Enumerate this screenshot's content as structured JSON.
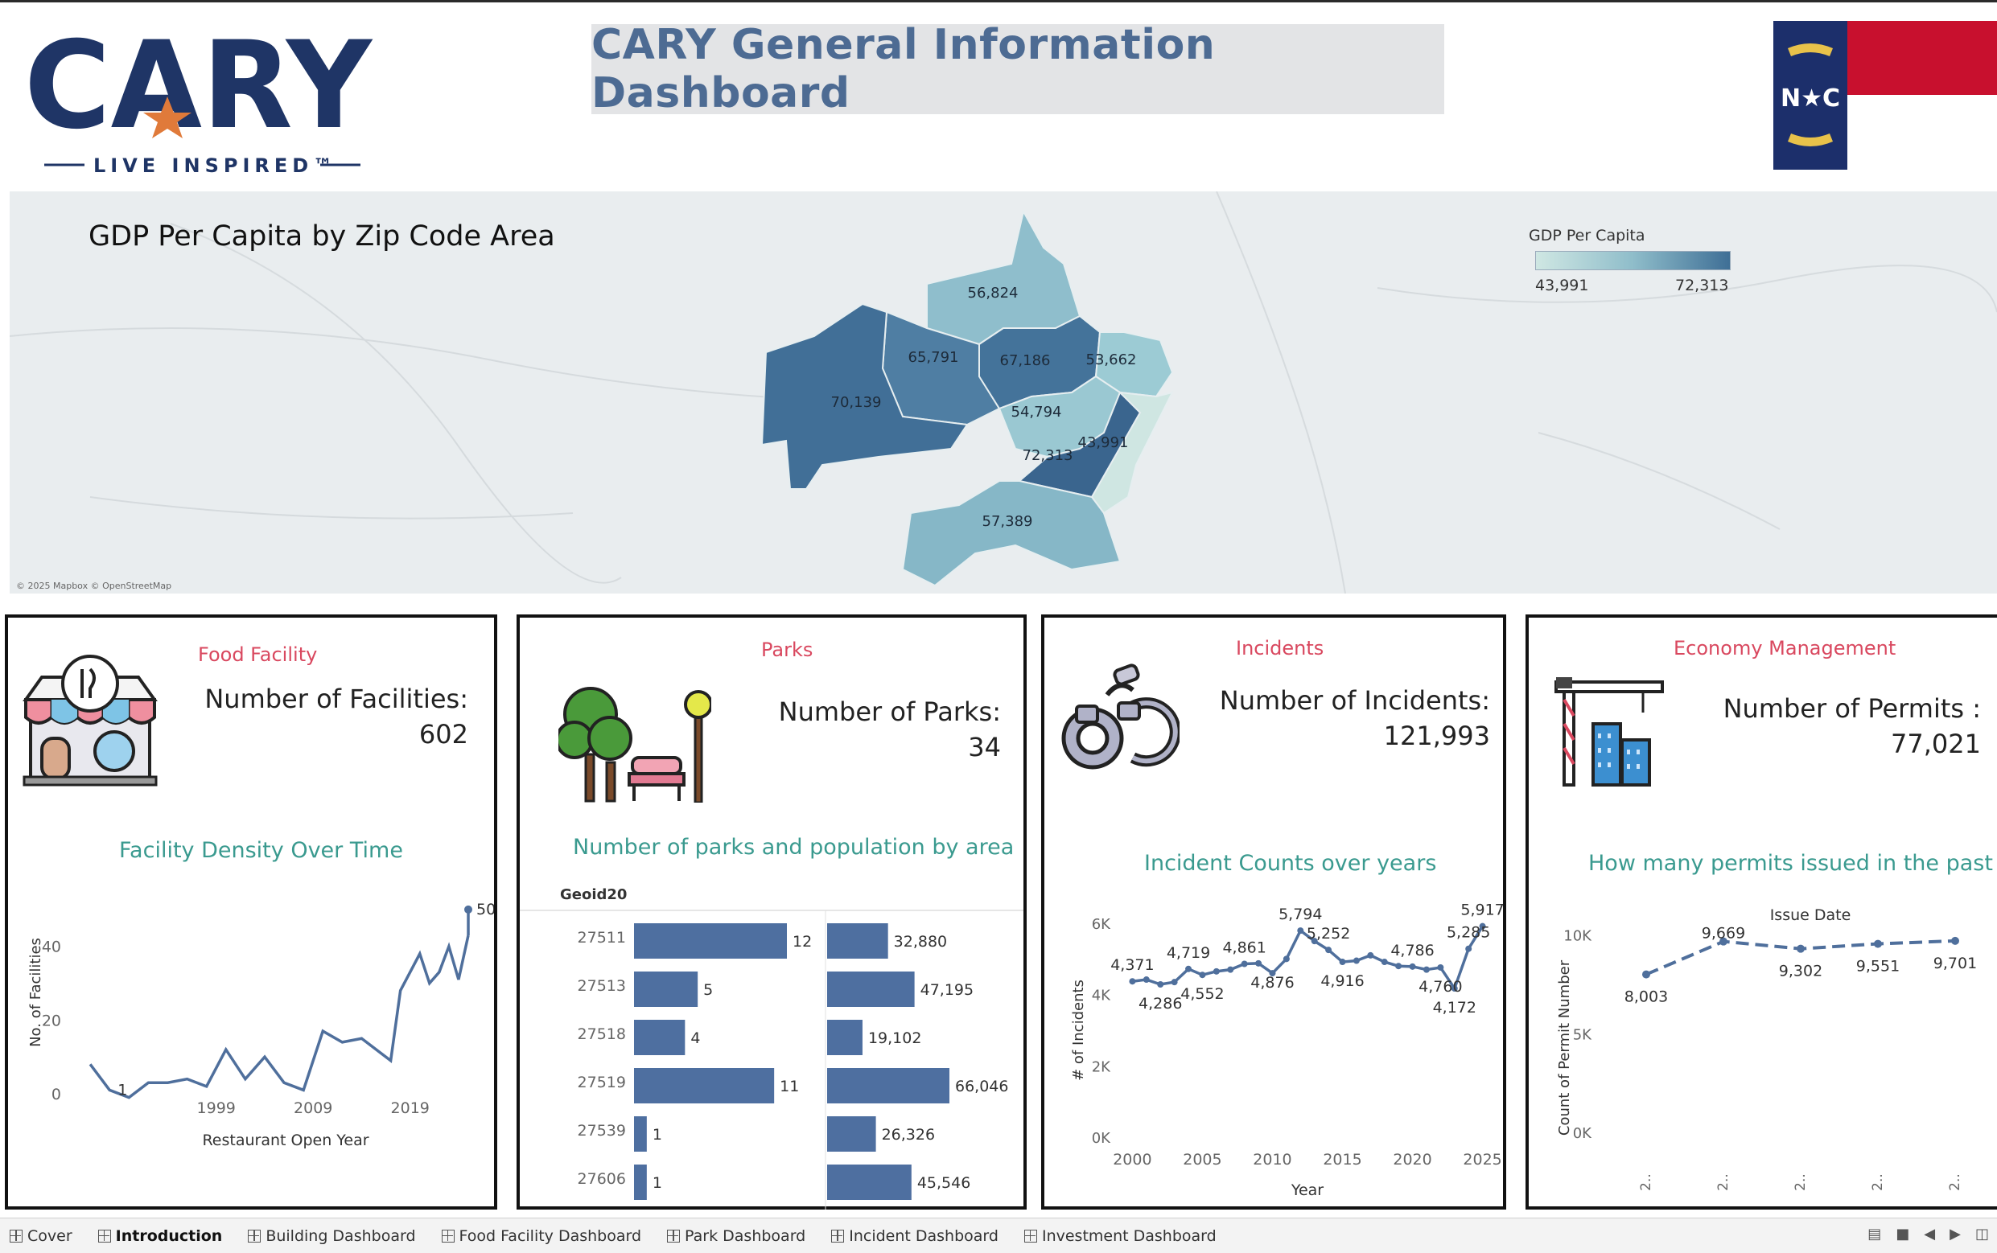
{
  "header": {
    "logo_text": "CARY",
    "logo_tagline": "LIVE INSPIRED™",
    "title": "CARY General Information Dashboard",
    "flag_text": "N★C"
  },
  "map": {
    "title": "GDP Per Capita by Zip Code Area",
    "legend_title": "GDP Per Capita",
    "legend_min": "43,991",
    "legend_max": "72,313",
    "credit": "© 2025 Mapbox © OpenStreetMap",
    "regions": [
      {
        "label": "56,824",
        "value": 56824
      },
      {
        "label": "65,791",
        "value": 65791
      },
      {
        "label": "67,186",
        "value": 67186
      },
      {
        "label": "53,662",
        "value": 53662
      },
      {
        "label": "70,139",
        "value": 70139
      },
      {
        "label": "54,794",
        "value": 54794
      },
      {
        "label": "72,313",
        "value": 72313
      },
      {
        "label": "43,991",
        "value": 43991
      },
      {
        "label": "57,389",
        "value": 57389
      }
    ]
  },
  "cards": {
    "food": {
      "heading": "Food Facility",
      "metric_label": "Number of Facilities:",
      "metric_value": "602",
      "chart_title": "Facility Density Over Time",
      "icon": "storefront-icon"
    },
    "parks": {
      "heading": "Parks",
      "metric_label": "Number of Parks:",
      "metric_value": "34",
      "chart_title": "Number of parks and population by area",
      "icon": "park-icon"
    },
    "incidents": {
      "heading": "Incidents",
      "metric_label": "Number of Incidents:",
      "metric_value": "121,993",
      "chart_title": "Incident Counts over years",
      "icon": "handcuffs-icon"
    },
    "economy": {
      "heading": "Economy Management",
      "metric_label": "Number of Permits :",
      "metric_value": "77,021",
      "chart_title": "How many permits issued in the past",
      "icon": "construction-crane-icon"
    }
  },
  "chart_data": [
    {
      "type": "line",
      "title": "Facility Density Over Time",
      "xlabel": "Restaurant Open Year",
      "ylabel": "No. of Facilities",
      "x_ticks": [
        "1999",
        "2009",
        "2019"
      ],
      "y_ticks": [
        "0",
        "20",
        "40"
      ],
      "ylim": [
        0,
        55
      ],
      "xlim": [
        1984,
        2025
      ],
      "x": [
        1986,
        1988,
        1990,
        1992,
        1994,
        1996,
        1998,
        2000,
        2002,
        2004,
        2006,
        2008,
        2010,
        2012,
        2014,
        2016,
        2017,
        2018,
        2019,
        2020,
        2021,
        2022,
        2023,
        2024,
        2025
      ],
      "values": [
        8,
        1,
        -1,
        3,
        3,
        4,
        2,
        12,
        4,
        10,
        3,
        1,
        17,
        14,
        15,
        11,
        9,
        28,
        33,
        38,
        30,
        33,
        40,
        31,
        43
      ],
      "annotations": [
        {
          "x": 1988,
          "y": 1,
          "label": "1"
        },
        {
          "x": 2025,
          "y": 50,
          "label": "50"
        }
      ],
      "end_value": 50
    },
    {
      "type": "bar",
      "title": "Number of parks and population by area",
      "category_header": "Geoid20",
      "categories": [
        "27511",
        "27513",
        "27518",
        "27519",
        "27539",
        "27606"
      ],
      "series": [
        {
          "values": [
            12,
            5,
            4,
            11,
            1,
            1
          ],
          "labels": [
            "12",
            "5",
            "4",
            "11",
            "1",
            "1"
          ]
        },
        {
          "values": [
            32880,
            47195,
            19102,
            66046,
            26326,
            45546
          ],
          "labels": [
            "32,880",
            "47,195",
            "19,102",
            "66,046",
            "26,326",
            "45,546"
          ]
        }
      ]
    },
    {
      "type": "line",
      "title": "Incident Counts over years",
      "xlabel": "Year",
      "ylabel": "# of Incidents",
      "x_ticks": [
        "2000",
        "2005",
        "2010",
        "2015",
        "2020",
        "2025"
      ],
      "y_ticks": [
        "0K",
        "2K",
        "4K",
        "6K"
      ],
      "ylim": [
        0,
        6000
      ],
      "xlim": [
        1999,
        2026
      ],
      "x": [
        2000,
        2001,
        2002,
        2003,
        2004,
        2005,
        2006,
        2007,
        2008,
        2009,
        2010,
        2011,
        2012,
        2013,
        2014,
        2015,
        2016,
        2017,
        2018,
        2019,
        2020,
        2021,
        2022,
        2023,
        2024,
        2025
      ],
      "values": [
        4371,
        4420,
        4286,
        4350,
        4719,
        4552,
        4650,
        4700,
        4861,
        4876,
        4600,
        5000,
        5794,
        5500,
        5252,
        4916,
        4950,
        5100,
        4916,
        4800,
        4786,
        4700,
        4760,
        4172,
        5285,
        5917
      ],
      "labels": [
        "4,371",
        "4,286",
        "4,719",
        "4,552",
        "4,861",
        "4,876",
        "5,794",
        "5,252",
        "4,916",
        "4,786",
        "4,760",
        "4,172",
        "5,285",
        "5,917"
      ],
      "labeled_points": [
        {
          "x": 2000,
          "y": 4371,
          "label": "4,371",
          "pos": "above"
        },
        {
          "x": 2002,
          "y": 4286,
          "label": "4,286",
          "pos": "below"
        },
        {
          "x": 2004,
          "y": 4719,
          "label": "4,719",
          "pos": "above"
        },
        {
          "x": 2005,
          "y": 4552,
          "label": "4,552",
          "pos": "below"
        },
        {
          "x": 2008,
          "y": 4861,
          "label": "4,861",
          "pos": "above"
        },
        {
          "x": 2010,
          "y": 4876,
          "label": "4,876",
          "pos": "below"
        },
        {
          "x": 2012,
          "y": 5794,
          "label": "5,794",
          "pos": "above"
        },
        {
          "x": 2014,
          "y": 5252,
          "label": "5,252",
          "pos": "above"
        },
        {
          "x": 2015,
          "y": 4916,
          "label": "4,916",
          "pos": "below"
        },
        {
          "x": 2020,
          "y": 4786,
          "label": "4,786",
          "pos": "above"
        },
        {
          "x": 2022,
          "y": 4760,
          "label": "4,760",
          "pos": "below"
        },
        {
          "x": 2023,
          "y": 4172,
          "label": "4,172",
          "pos": "below"
        },
        {
          "x": 2024,
          "y": 5285,
          "label": "5,285",
          "pos": "above"
        },
        {
          "x": 2025,
          "y": 5917,
          "label": "5,917",
          "pos": "above"
        }
      ]
    },
    {
      "type": "line",
      "title": "How many permits issued in the past",
      "xlabel": "Issue Date",
      "ylabel": "Count of Permit Number",
      "y_ticks": [
        "0K",
        "5K",
        "10K"
      ],
      "ylim": [
        0,
        11000
      ],
      "categories": [
        "2..",
        "2..",
        "2..",
        "2..",
        "2.."
      ],
      "values": [
        8003,
        9669,
        9302,
        9551,
        9701
      ],
      "labels": [
        "8,003",
        "9,669",
        "9,302",
        "9,551",
        "9,701"
      ]
    }
  ],
  "tabs": [
    {
      "label": "Cover",
      "active": false
    },
    {
      "label": "Introduction",
      "active": true
    },
    {
      "label": "Building Dashboard",
      "active": false
    },
    {
      "label": "Food Facility Dashboard",
      "active": false
    },
    {
      "label": "Park Dashboard",
      "active": false
    },
    {
      "label": "Incident Dashboard",
      "active": false
    },
    {
      "label": "Investment Dashboard",
      "active": false
    }
  ],
  "colors": {
    "title_blue": "#4d6b93",
    "heading_red": "#d9485f",
    "subtitle_teal": "#3a9a8f",
    "line_blue": "#4f6f9c",
    "bar_blue": "#4e6fa0",
    "logo_navy": "#1f3566",
    "logo_orange": "#e07a3a"
  }
}
